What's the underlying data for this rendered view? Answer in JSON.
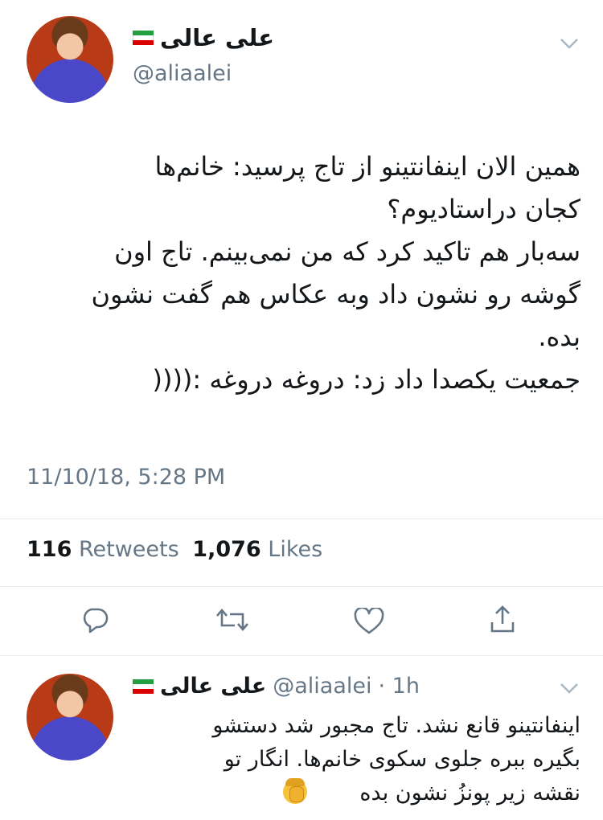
{
  "tweet": {
    "author_name": "علی عالی",
    "author_handle": "@aliaalei",
    "text": "همین الان اینفانتینو از تاج پرسید: خانم‌ها\nکجان دراستادیوم؟\nسه‌بار هم تاکید کرد که من نمی‌بینم. تاج اون\nگوشه رو نشون داد وبه عکاس هم گفت نشون\nبده.\nجمعیت یکصدا داد زد: دروغه دروغه :((((",
    "timestamp": "11/10/18, 5:28 PM",
    "retweets_count": "116",
    "retweets_label": "Retweets",
    "likes_count": "1,076",
    "likes_label": "Likes"
  },
  "reply": {
    "author_name": "علی عالی",
    "author_handle": "@aliaalei",
    "time": "· 1h",
    "text": "اینفانتینو قانع نشد. تاج مجبور شد دستشو\nبگیره ببره جلوی سکوی خانم‌ها. انگار تو\nنقشه زیر پونزُ نشون بده"
  },
  "icons": {
    "reply": "reply-icon",
    "retweet": "retweet-icon",
    "like": "heart-icon",
    "share": "share-icon",
    "menu": "chevron-down-icon",
    "flag": "iran-flag-icon",
    "emoji": "facepalm-emoji"
  },
  "colors": {
    "text": "#14171a",
    "secondary": "#657786",
    "divider": "#e6ecf0"
  }
}
